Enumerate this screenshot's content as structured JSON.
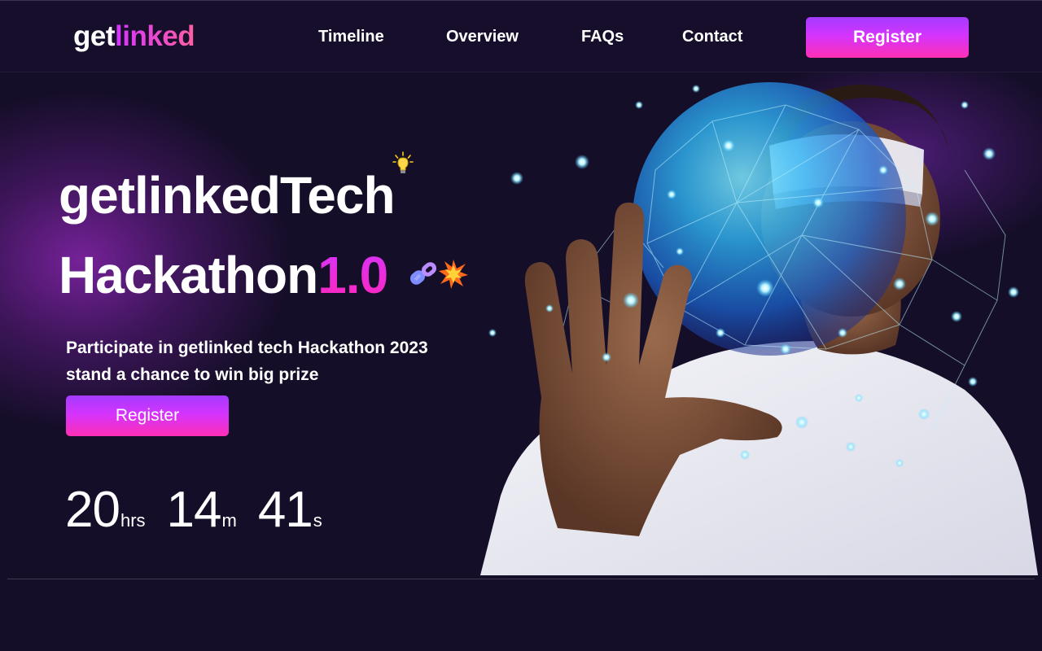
{
  "nav": {
    "logo_part1": "get",
    "logo_part2": "linked",
    "links": [
      "Timeline",
      "Overview",
      "FAQs",
      "Contact"
    ],
    "register_label": "Register"
  },
  "hero": {
    "title_line1": "getlinkedTech",
    "title_line2_main": "Hackathon",
    "title_line2_version": "1.0",
    "subtitle_line1": "Participate in getlinked tech Hackathon 2023",
    "subtitle_line2": "stand a chance to win big prize",
    "register_label": "Register",
    "countdown": {
      "hours": "20",
      "hours_unit": "hrs",
      "minutes": "14",
      "minutes_unit": "m",
      "seconds": "41",
      "seconds_unit": "s"
    }
  },
  "colors": {
    "background": "#150e28",
    "accent_purple": "#d434fe",
    "accent_pink": "#ff26b9",
    "button_violet": "#903aff"
  },
  "icons": [
    "lightbulb-icon",
    "link-icon",
    "explosion-icon"
  ]
}
